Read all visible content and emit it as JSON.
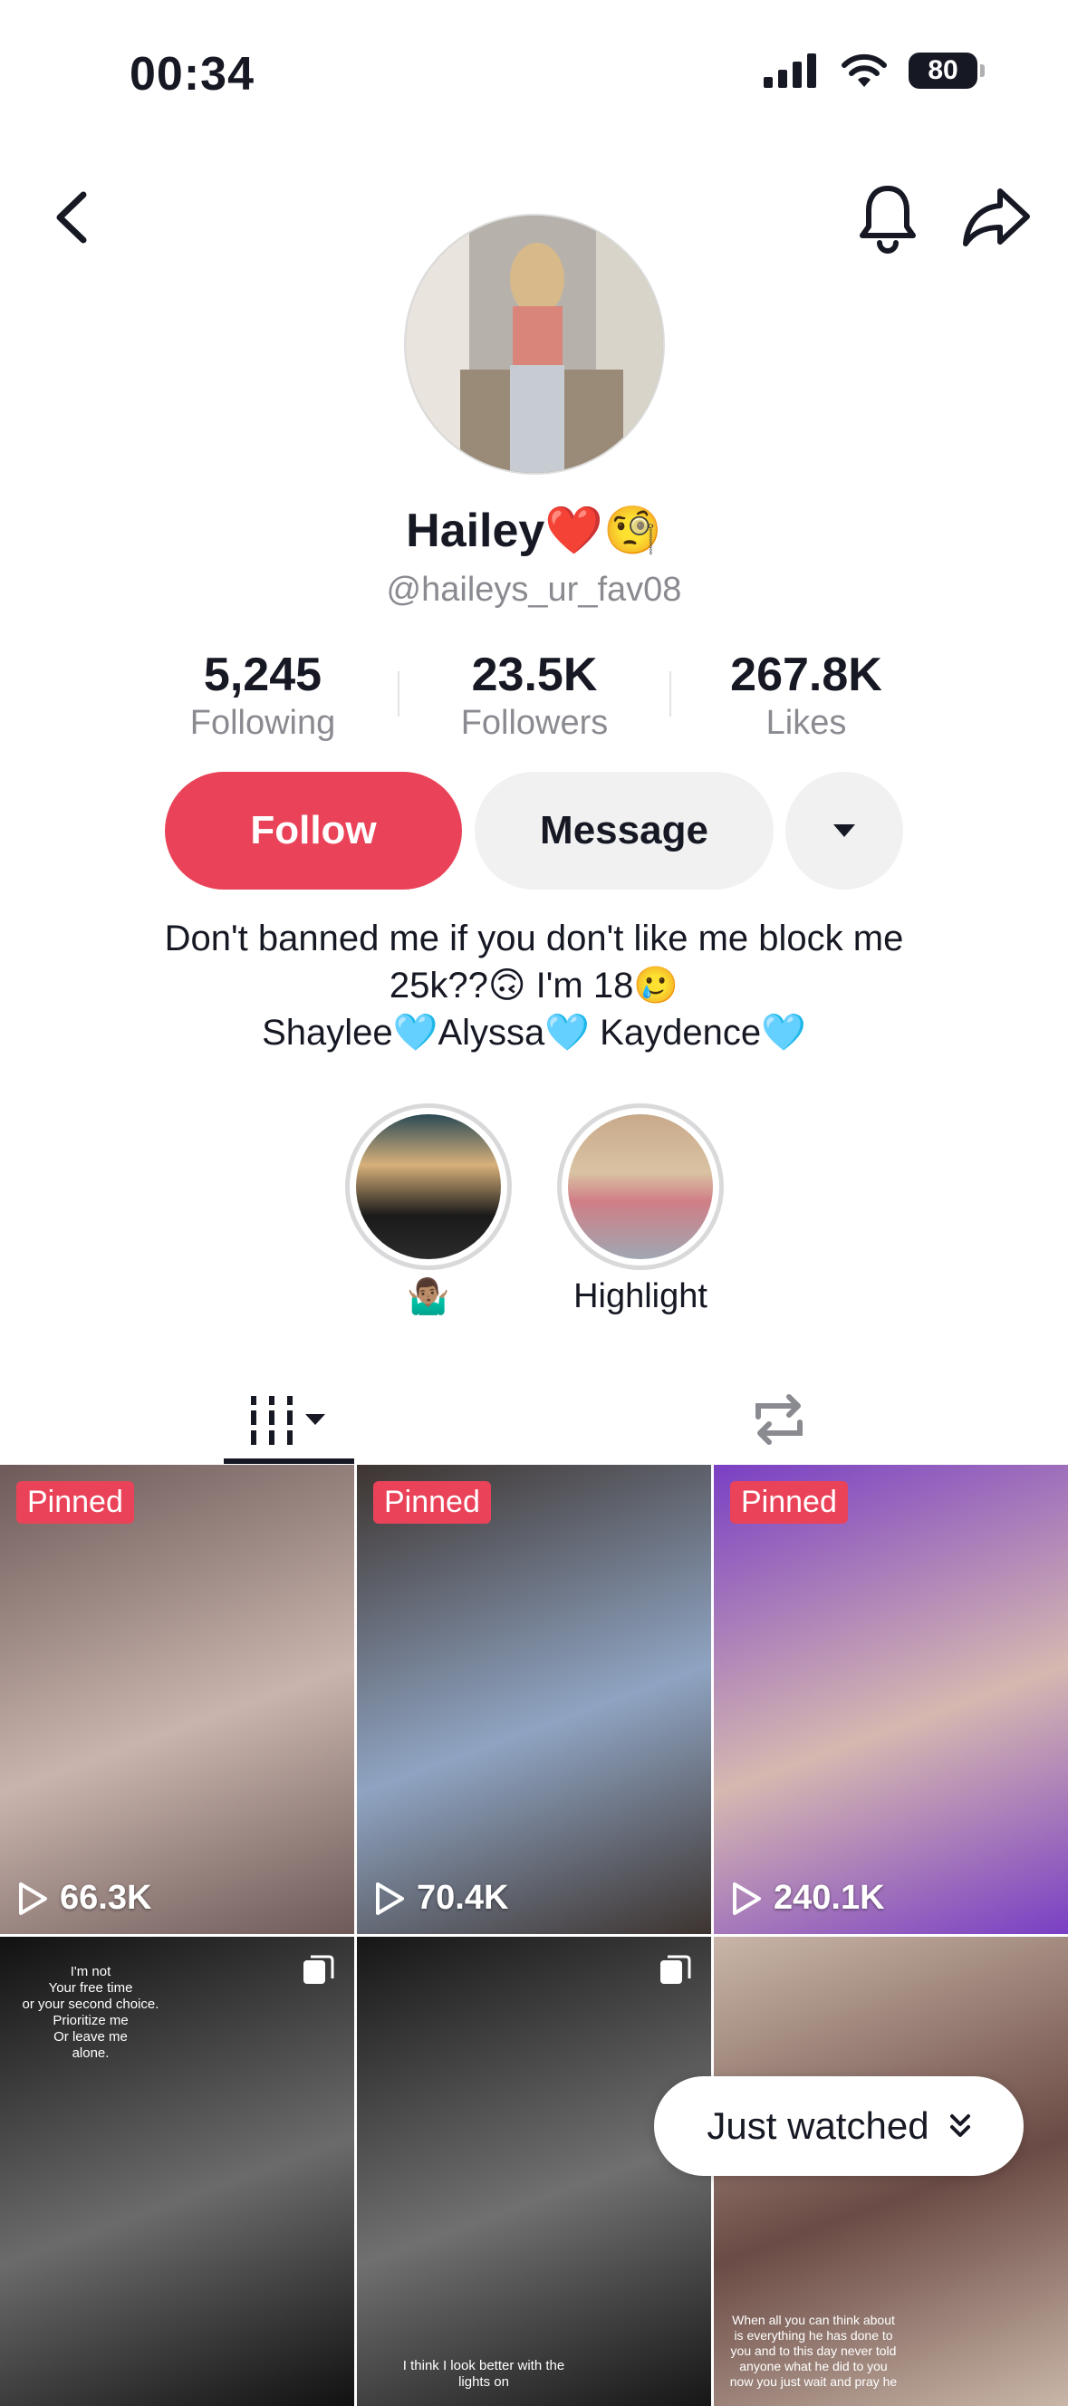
{
  "status_bar": {
    "time": "00:34",
    "battery": "80"
  },
  "profile": {
    "name": "Hailey",
    "name_emojis": "❤️🧐",
    "handle": "@haileys_ur_fav08"
  },
  "stats": [
    {
      "value": "5,245",
      "label": "Following"
    },
    {
      "value": "23.5K",
      "label": "Followers"
    },
    {
      "value": "267.8K",
      "label": "Likes"
    }
  ],
  "actions": {
    "follow": "Follow",
    "message": "Message"
  },
  "bio": {
    "line1": "Don't banned me if you don't like me block me",
    "line2": "25k??🙃 I'm 18🥲",
    "line3": "Shaylee🩵Alyssa🩵 Kaydence🩵"
  },
  "highlights": [
    {
      "label": "🤷🏽‍♂️"
    },
    {
      "label": "Highlight"
    }
  ],
  "videos": [
    {
      "pinned": "Pinned",
      "views": "66.3K",
      "colors": [
        "#6e5a58",
        "#c9b4ad"
      ]
    },
    {
      "pinned": "Pinned",
      "views": "70.4K",
      "colors": [
        "#3d3430",
        "#8fa4c2"
      ]
    },
    {
      "pinned": "Pinned",
      "views": "240.1K",
      "colors": [
        "#7a3fc4",
        "#d6b8b0"
      ]
    },
    {
      "caption": "I'm not\nYour free time\nor your second choice.\nPrioritize me\nOr leave me\nalone.",
      "colors": [
        "#111111",
        "#6b6b6b"
      ]
    },
    {
      "caption": "I think I look better with the\nlights on",
      "colors": [
        "#161616",
        "#707070"
      ]
    },
    {
      "caption": "When all you can think about\nis everything he has done to\nyou and to this day never told\nanyone what he did to you\nnow you just wait and pray he",
      "colors": [
        "#c9b6a8",
        "#6b4b45"
      ]
    }
  ],
  "just_watched": "Just watched",
  "colors": {
    "accent": "#ea4359",
    "text": "#161823",
    "secondary": "#8a8b91",
    "button_bg": "#f1f1f2"
  }
}
